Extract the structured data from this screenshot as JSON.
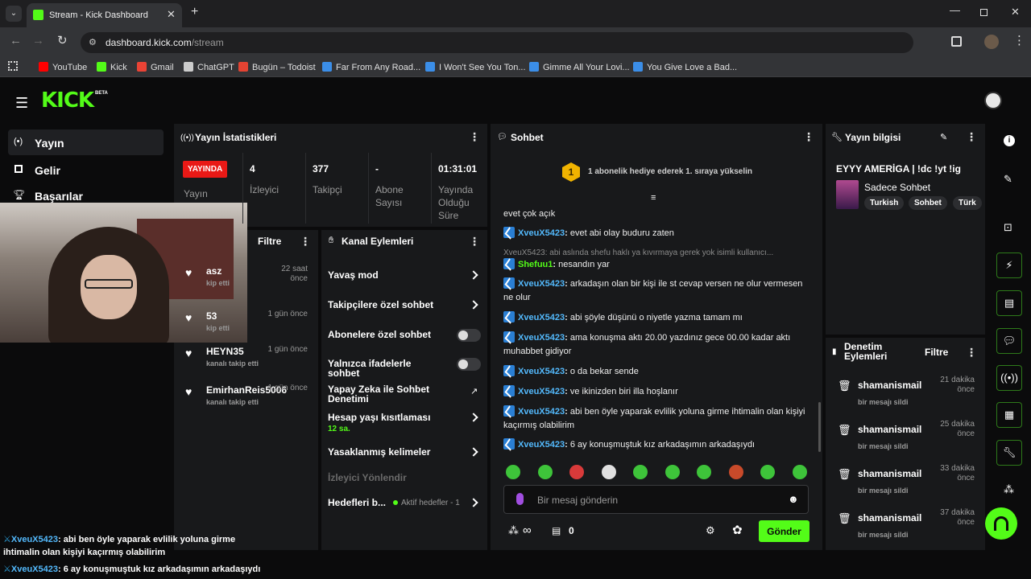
{
  "browser": {
    "tab_title": "Stream - Kick Dashboard",
    "url_host": "dashboard.kick.com",
    "url_path": "/stream",
    "bookmarks": [
      {
        "label": "YouTube",
        "color": "#ff0000"
      },
      {
        "label": "Kick",
        "color": "#53fc18"
      },
      {
        "label": "Gmail",
        "color": "#ea4335"
      },
      {
        "label": "ChatGPT",
        "color": "#cccccc"
      },
      {
        "label": "Bugün – Todoist",
        "color": "#e44332"
      },
      {
        "label": "Far From Any Road...",
        "color": "#3b8ee8"
      },
      {
        "label": "I Won't See You Ton...",
        "color": "#3b8ee8"
      },
      {
        "label": "Gimme All Your Lovi...",
        "color": "#3b8ee8"
      },
      {
        "label": "You Give Love a Bad...",
        "color": "#3b8ee8"
      }
    ]
  },
  "app": {
    "logo": "KICK",
    "logo_badge": "BETA",
    "accent": "#53fc18"
  },
  "sidebar": {
    "items": [
      {
        "label": "Yayın",
        "icon": "broadcast-icon"
      },
      {
        "label": "Gelir",
        "icon": "chart-icon"
      },
      {
        "label": "Başarılar",
        "icon": "trophy-icon"
      }
    ]
  },
  "stats": {
    "title": "Yayın İstatistikleri",
    "live_badge": "YAYINDA",
    "live_label": "Yayın",
    "items": [
      {
        "value": "4",
        "label": "İzleyici"
      },
      {
        "value": "377",
        "label": "Takipçi"
      },
      {
        "value": "-",
        "label": "Abone Sayısı"
      },
      {
        "value": "01:31:01",
        "label": "Yayında Olduğu Süre"
      }
    ]
  },
  "activity": {
    "filter_label": "Filtre",
    "items": [
      {
        "user": "asz",
        "action": "kip etti",
        "time": "22 saat önce"
      },
      {
        "user": "53",
        "action": "kip etti",
        "time": "1 gün önce"
      },
      {
        "user": "HEYN35",
        "action": "kanalı takip etti",
        "time": "1 gün önce"
      },
      {
        "user": "EmirhanReis5006",
        "action": "kanalı takip etti",
        "time": "1 gün önce"
      }
    ]
  },
  "channel_actions": {
    "title": "Kanal Eylemleri",
    "items": [
      {
        "label": "Yavaş mod"
      },
      {
        "label": "Takipçilere özel sohbet"
      },
      {
        "label": "Abonelere özel sohbet"
      },
      {
        "label": "Yalnızca ifadelerle sohbet"
      },
      {
        "label": "Yapay Zeka ile Sohbet Denetimi"
      },
      {
        "label": "Hesap yaşı kısıtlaması",
        "sub": "12 sa."
      },
      {
        "label": "Yasaklanmış kelimeler"
      },
      {
        "label": "İzleyici Yönlendir"
      },
      {
        "label": "Hedefleri b...",
        "sub": "Aktif hedefler - 1"
      }
    ]
  },
  "chat": {
    "title": "Sohbet",
    "gift_rank": "1",
    "gift_text": "1 abonelik hediye ederek 1. sıraya yükselin",
    "top_partial": "evet çok açık",
    "reply_preview": "XveuX5423: abi aslında shefu haklı ya kıvırmaya gerek yok isimli kullanıcı...",
    "messages": [
      {
        "user": "XveuX5423",
        "text": "evet abi olay buduru zaten"
      },
      {
        "user": "Shefuu1",
        "text": "nesandın yar"
      },
      {
        "user": "XveuX5423",
        "text": "arkadaşın olan bir kişi ile st cevap versen ne olur vermesen ne olur"
      },
      {
        "user": "XveuX5423",
        "text": "abi şöyle düşünü o niyetle yazma tamam mı"
      },
      {
        "user": "XveuX5423",
        "text": "ama konuşma aktı 20.00 yazdınız gece 00.00 kadar aktı muhabbet gidiyor"
      },
      {
        "user": "XveuX5423",
        "text": "o da bekar sende"
      },
      {
        "user": "XveuX5423",
        "text": "ve ikinizden biri illa hoşlanır"
      },
      {
        "user": "XveuX5423",
        "text": "abi ben öyle yaparak evlilik yoluna girme ihtimalin olan kişiyi kaçırmış olabilirim"
      },
      {
        "user": "XveuX5423",
        "text": "6 ay konuşmuştuk kız arkadaşımın arkadaşıydı"
      }
    ],
    "input_placeholder": "Bir mesaj gönderin",
    "points": "∞",
    "drops": "0",
    "send_label": "Gönder"
  },
  "stream_info": {
    "title": "Yayın bilgisi",
    "stream_title": "EYYY AMERİGA | !dc !yt !ig",
    "category": "Sadece Sohbet",
    "tags": [
      "Turkish",
      "Sohbet",
      "Türk"
    ]
  },
  "moderation": {
    "title": "Denetim Eylemleri",
    "filter_label": "Filtre",
    "items": [
      {
        "user": "shamanismail",
        "action": "bir mesajı sildi",
        "time": "21 dakika önce"
      },
      {
        "user": "shamanismail",
        "action": "bir mesajı sildi",
        "time": "25 dakika önce"
      },
      {
        "user": "shamanismail",
        "action": "bir mesajı sildi",
        "time": "33 dakika önce"
      },
      {
        "user": "shamanismail",
        "action": "bir mesajı sildi",
        "time": "37 dakika önce"
      }
    ]
  },
  "overlay": {
    "lines": [
      {
        "user": "XveuX5423",
        "text": "abi ben öyle yaparak evlilik yoluna girme ihtimalin olan kişiyi kaçırmış olabilirim"
      },
      {
        "user": "XveuX5423",
        "text": "6 ay konuşmuştuk kız arkadaşımın arkadaşıydı"
      }
    ]
  }
}
